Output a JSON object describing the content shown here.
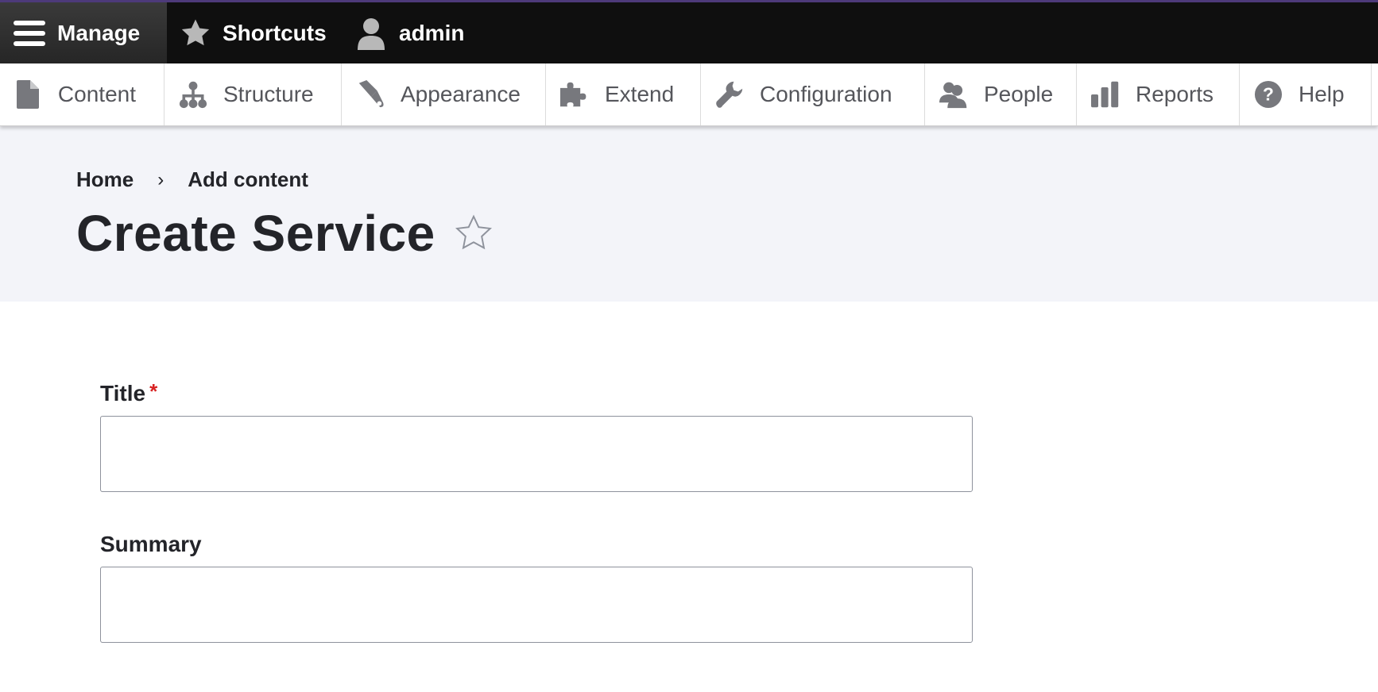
{
  "toolbar": {
    "manage_label": "Manage",
    "shortcuts_label": "Shortcuts",
    "user_label": "admin",
    "accent_color": "#4d3a7a"
  },
  "tray": {
    "items": [
      {
        "label": "Content",
        "icon": "file-icon"
      },
      {
        "label": "Structure",
        "icon": "sitemap-icon"
      },
      {
        "label": "Appearance",
        "icon": "paintbrush-icon"
      },
      {
        "label": "Extend",
        "icon": "puzzle-icon"
      },
      {
        "label": "Configuration",
        "icon": "wrench-icon"
      },
      {
        "label": "People",
        "icon": "people-icon"
      },
      {
        "label": "Reports",
        "icon": "bar-chart-icon"
      },
      {
        "label": "Help",
        "icon": "help-icon"
      }
    ]
  },
  "breadcrumb": {
    "home": "Home",
    "separator": "›",
    "current": "Add content"
  },
  "page": {
    "title": "Create Service"
  },
  "form": {
    "title_label": "Title",
    "title_required_marker": "*",
    "title_value": "",
    "summary_label": "Summary",
    "summary_value": ""
  }
}
